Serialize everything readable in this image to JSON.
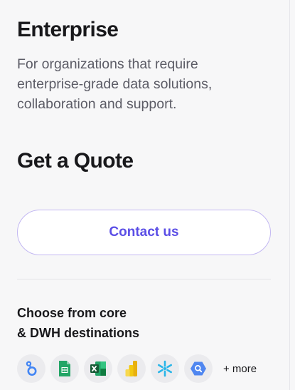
{
  "plan": {
    "title": "Enterprise",
    "description": "For organizations that require enterprise-grade data solutions, collaboration and support.",
    "price": "Get a Quote",
    "cta_label": "Contact us"
  },
  "destinations": {
    "heading_line1": "Choose from core",
    "heading_line2": "& DWH destinations",
    "icons": [
      "looker-studio-icon",
      "google-sheets-icon",
      "excel-icon",
      "power-bi-icon",
      "snowflake-icon",
      "bigquery-icon"
    ],
    "more_label": "+ more"
  },
  "colors": {
    "accent": "#5b4ee6",
    "button_border": "#c3b8f2",
    "background": "#f7f7f8",
    "text_primary": "#18181b",
    "text_secondary": "#5c5c66"
  }
}
